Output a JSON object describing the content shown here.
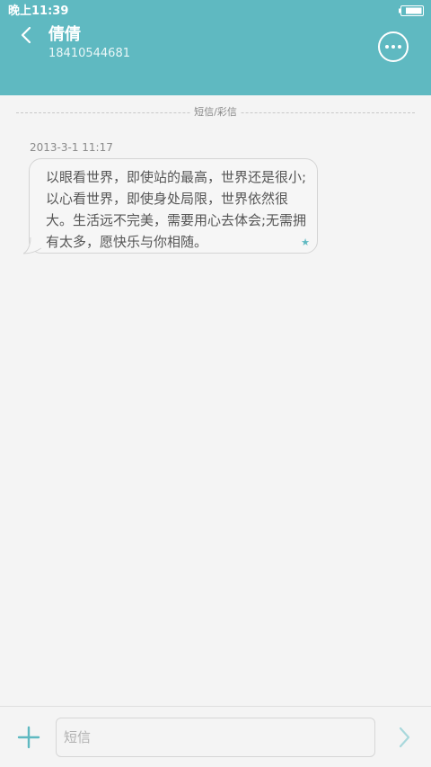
{
  "status_bar": {
    "time": "晚上11:39"
  },
  "header": {
    "contact_name": "倩倩",
    "contact_number": "18410544681"
  },
  "conversation": {
    "divider_label": "短信/彩信",
    "messages": [
      {
        "timestamp": "2013-3-1 11:17",
        "text": "以眼看世界，即使站的最高，世界还是很小;以心看世界，即使身处局限，世界依然很大。生活远不完美，需要用心去体会;无需拥有太多，愿快乐与你相随。"
      }
    ]
  },
  "composer": {
    "placeholder": "短信"
  },
  "colors": {
    "accent": "#5fb9c1",
    "background": "#f4f4f4"
  }
}
